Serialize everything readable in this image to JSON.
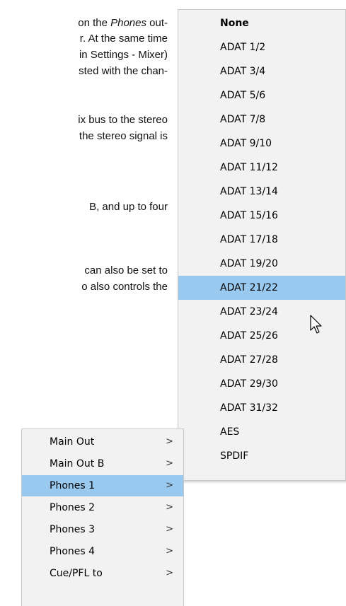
{
  "document": {
    "lines": [
      {
        "pre": "on the ",
        "em": "Phones",
        "post": " out-"
      },
      {
        "text": "r. At the same time"
      },
      {
        "text": "in Settings - Mixer)"
      },
      {
        "text": "sted with the chan-"
      },
      {
        "text": "ix bus to the stereo"
      },
      {
        "text": "the stereo signal is"
      },
      {
        "text": "B, and up to four"
      },
      {
        "text": "can also be set to"
      },
      {
        "text": "o also controls the"
      }
    ]
  },
  "submenu": {
    "items": [
      {
        "label": "None",
        "bold": true
      },
      {
        "label": "ADAT 1/2"
      },
      {
        "label": "ADAT 3/4"
      },
      {
        "label": "ADAT 5/6"
      },
      {
        "label": "ADAT 7/8"
      },
      {
        "label": "ADAT 9/10"
      },
      {
        "label": "ADAT 11/12"
      },
      {
        "label": "ADAT 13/14"
      },
      {
        "label": "ADAT 15/16"
      },
      {
        "label": "ADAT 17/18"
      },
      {
        "label": "ADAT 19/20"
      },
      {
        "label": "ADAT 21/22",
        "selected": true
      },
      {
        "label": "ADAT 23/24"
      },
      {
        "label": "ADAT 25/26"
      },
      {
        "label": "ADAT 27/28"
      },
      {
        "label": "ADAT 29/30"
      },
      {
        "label": "ADAT 31/32"
      },
      {
        "label": "AES"
      },
      {
        "label": "SPDIF"
      }
    ],
    "selected_color": "#99c9ef"
  },
  "menu": {
    "items": [
      {
        "label": "Main Out",
        "arrow": ">"
      },
      {
        "label": "Main Out B",
        "arrow": ">"
      },
      {
        "label": "Phones 1",
        "arrow": ">",
        "selected": true
      },
      {
        "label": "Phones 2",
        "arrow": ">"
      },
      {
        "label": "Phones 3",
        "arrow": ">"
      },
      {
        "label": "Phones 4",
        "arrow": ">"
      },
      {
        "label": "Cue/PFL to",
        "arrow": ">"
      }
    ]
  },
  "icons": {
    "cursor": "arrow-pointer-icon"
  }
}
